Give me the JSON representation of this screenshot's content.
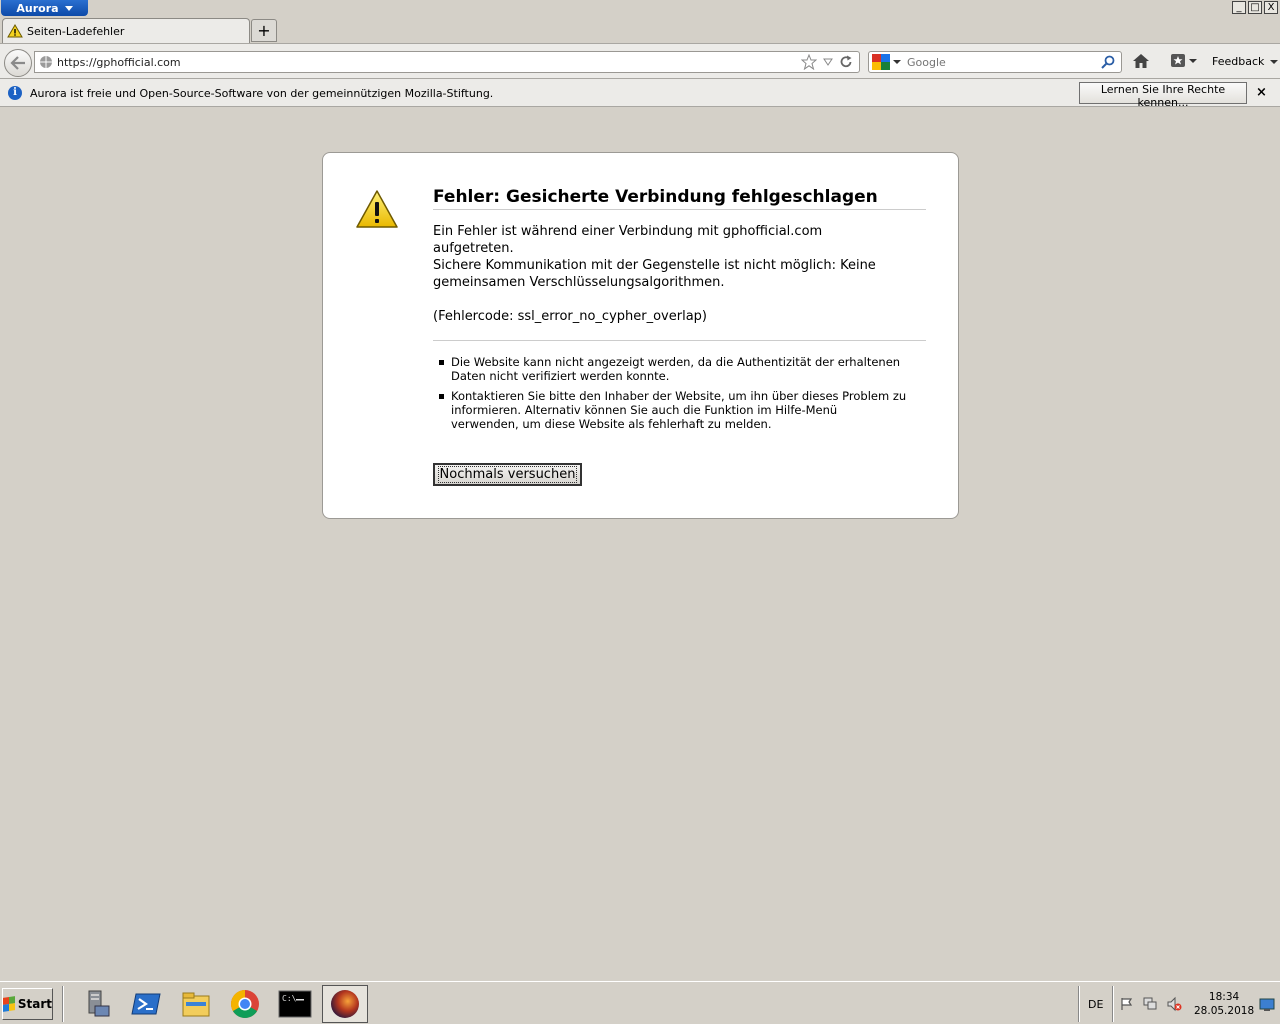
{
  "window": {
    "app_menu_label": "Aurora",
    "controls": [
      "_",
      "□",
      "X"
    ]
  },
  "tabs": [
    {
      "label": "Seiten-Ladefehler",
      "icon": "warning-icon"
    }
  ],
  "newtab_label": "+",
  "nav": {
    "url": "https://gphofficial.com",
    "search_placeholder": "Google",
    "feedback_label": "Feedback"
  },
  "notification": {
    "message": "Aurora ist freie und Open-Source-Software von der gemeinnützigen Mozilla-Stiftung.",
    "button_label": "Lernen Sie Ihre Rechte kennen...",
    "close_label": "×"
  },
  "error_page": {
    "title": "Fehler: Gesicherte Verbindung fehlgeschlagen",
    "line1": "Ein Fehler ist während einer Verbindung mit gphofficial.com aufgetreten.",
    "line2": "Sichere Kommunikation mit der Gegenstelle ist nicht möglich: Keine gemeinsamen Verschlüsselungsalgorithmen.",
    "line3": "(Fehlercode: ssl_error_no_cypher_overlap)",
    "bullets": [
      "Die Website kann nicht angezeigt werden, da die Authentizität der erhaltenen Daten nicht verifiziert werden konnte.",
      "Kontaktieren Sie bitte den Inhaber der Website, um ihn über dieses Problem zu informieren. Alternativ können Sie auch die Funktion im Hilfe-Menü verwenden, um diese Website als fehlerhaft zu melden."
    ],
    "retry_label": "Nochmals versuchen"
  },
  "taskbar": {
    "start_label": "Start",
    "items": [
      "server-manager-icon",
      "powershell-icon",
      "explorer-icon",
      "chrome-icon",
      "cmd-icon",
      "aurora-icon"
    ],
    "lang": "DE",
    "time": "18:34",
    "date": "28.05.2018"
  }
}
